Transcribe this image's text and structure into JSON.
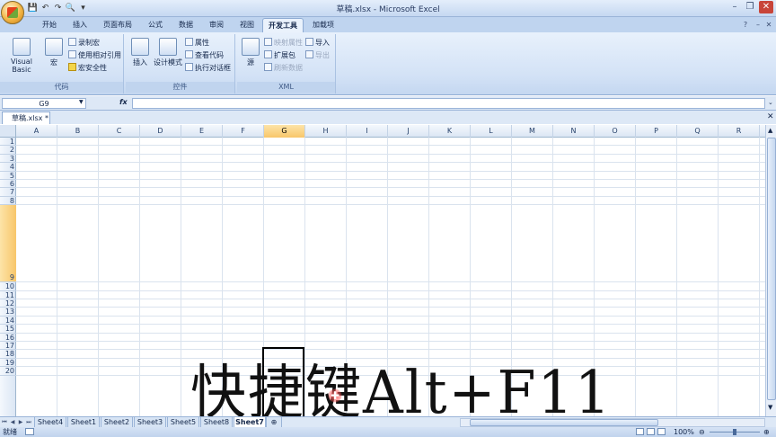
{
  "app": {
    "title": "草稿.xlsx - Microsoft Excel",
    "accent": "#c0d4ee"
  },
  "window_controls": {
    "minimize": "–",
    "restore": "❐",
    "close": "✕",
    "doc_min": "–",
    "doc_restore": "❐",
    "doc_close": "✕"
  },
  "qat": {
    "save": "💾",
    "undo": "↶",
    "redo": "↷",
    "preview": "🔍",
    "more": "▾"
  },
  "tabs": [
    "开始",
    "插入",
    "页面布局",
    "公式",
    "数据",
    "审阅",
    "视图",
    "开发工具",
    "加载项"
  ],
  "active_tab": "开发工具",
  "ribbon": {
    "code": {
      "label": "代码",
      "visual_basic": "Visual Basic",
      "macro": "宏",
      "record_macro": "录制宏",
      "relative_ref": "使用相对引用",
      "macro_security": "宏安全性"
    },
    "controls": {
      "label": "控件",
      "insert": "插入",
      "design_mode": "设计模式",
      "properties": "属性",
      "view_code": "查看代码",
      "run_dialog": "执行对话框"
    },
    "xml": {
      "label": "XML",
      "source": "源",
      "map_props": "映射属性",
      "expansion": "扩展包",
      "refresh": "刷新数据",
      "import": "导入",
      "export": "导出"
    }
  },
  "formula_bar": {
    "name_box": "G9",
    "fx": "fx",
    "formula": ""
  },
  "workbook_tab": "草稿.xlsx *",
  "columns": [
    "A",
    "B",
    "C",
    "D",
    "E",
    "F",
    "G",
    "H",
    "I",
    "J",
    "K",
    "L",
    "M",
    "N",
    "O",
    "P",
    "Q",
    "R"
  ],
  "selected_column": "G",
  "rows": [
    "1",
    "2",
    "3",
    "4",
    "5",
    "6",
    "7",
    "8",
    "9",
    "10",
    "11",
    "12",
    "13",
    "14",
    "15",
    "16",
    "17",
    "18",
    "19",
    "20"
  ],
  "selected_row": "9",
  "cell_text": "快捷键Alt+F11",
  "sheets": [
    "Sheet4",
    "Sheet1",
    "Sheet2",
    "Sheet3",
    "Sheet5",
    "Sheet8",
    "Sheet7"
  ],
  "active_sheet": "Sheet7",
  "status": {
    "left": "就绪",
    "zoom": "100%"
  }
}
